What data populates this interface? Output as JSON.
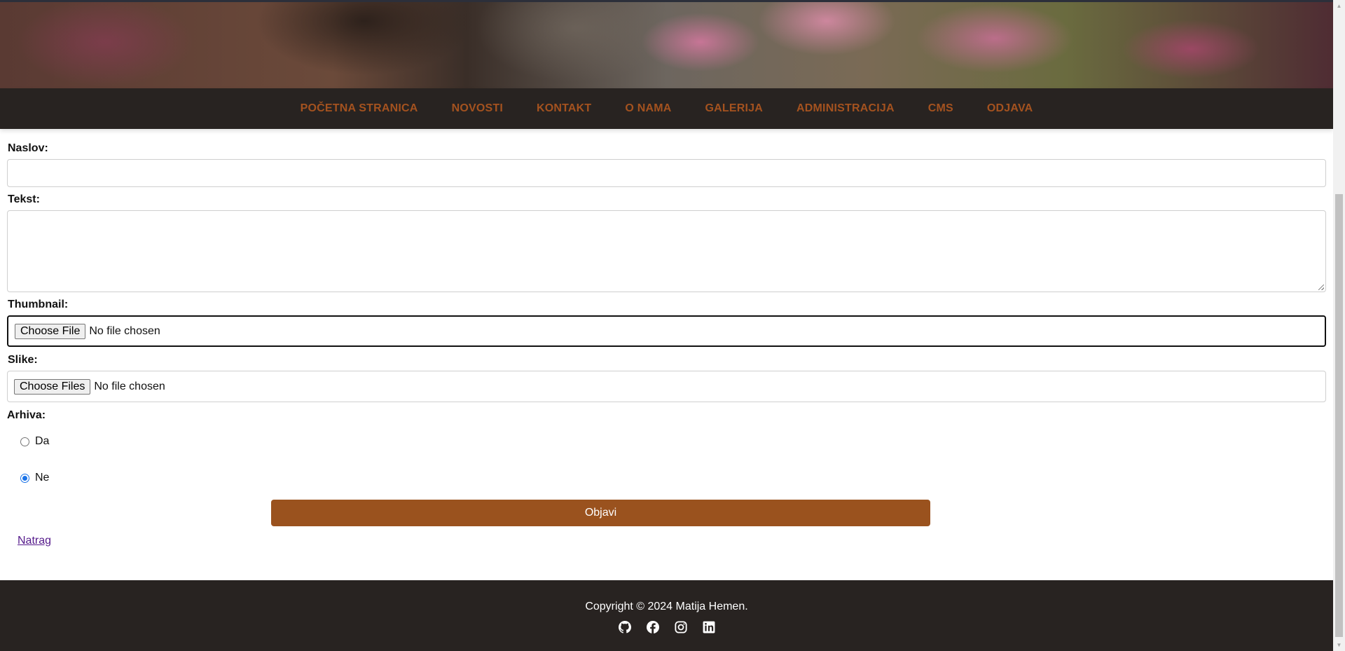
{
  "nav": {
    "items": [
      "POČETNA STRANICA",
      "NOVOSTI",
      "KONTAKT",
      "O NAMA",
      "GALERIJA",
      "ADMINISTRACIJA",
      "CMS",
      "ODJAVA"
    ]
  },
  "form": {
    "title_label": "Naslov:",
    "title_value": "",
    "text_label": "Tekst:",
    "text_value": "",
    "thumbnail_label": "Thumbnail:",
    "thumbnail_button": "Choose File",
    "thumbnail_status": "No file chosen",
    "images_label": "Slike:",
    "images_button": "Choose Files",
    "images_status": "No file chosen",
    "archive_label": "Arhiva:",
    "archive_options": [
      "Da",
      "Ne"
    ],
    "archive_selected": "Ne",
    "submit_label": "Objavi",
    "back_label": "Natrag"
  },
  "footer": {
    "copyright": "Copyright © 2024 Matija Hemen.",
    "social_icons": [
      "github-icon",
      "facebook-icon",
      "instagram-icon",
      "linkedin-icon"
    ]
  },
  "colors": {
    "nav_bg": "#282321",
    "nav_link": "#a4521f",
    "accent": "#9a521e",
    "link_visited": "#551a8b"
  }
}
